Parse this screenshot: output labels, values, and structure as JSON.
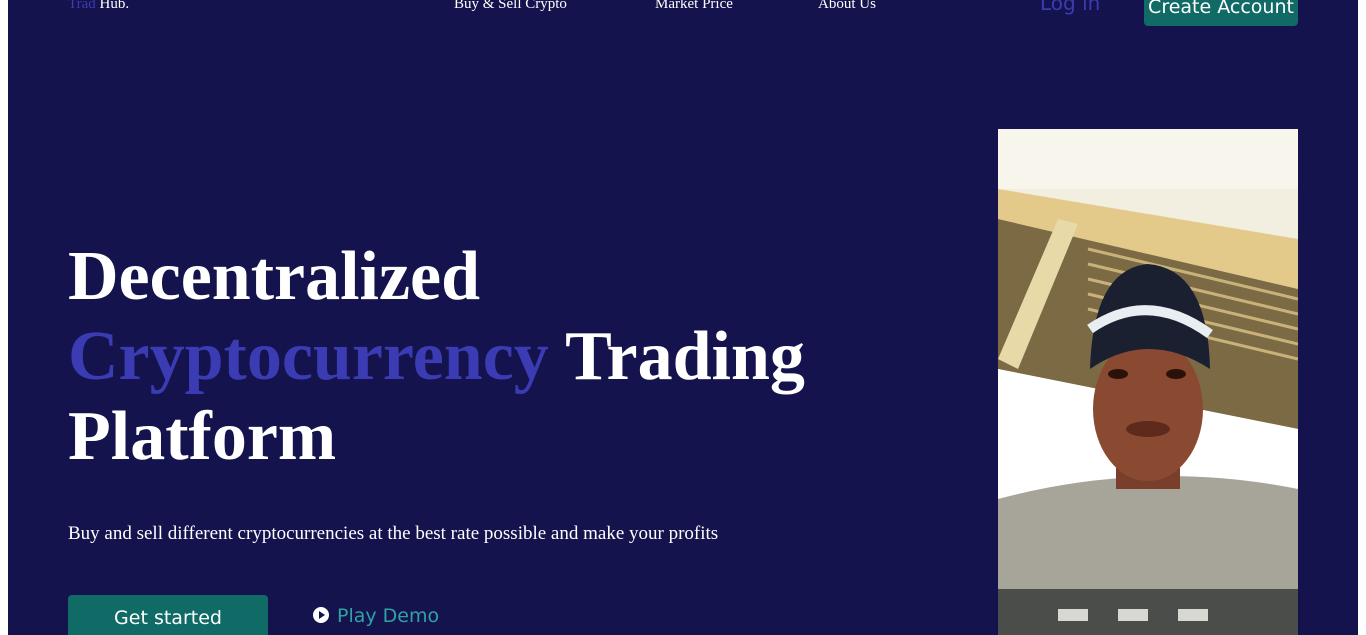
{
  "logo": {
    "accent": "Trad",
    "rest": "Hub."
  },
  "nav": {
    "links": [
      "Buy & Sell Crypto",
      "Market Price",
      "About Us"
    ],
    "login": "Log in",
    "create_account": "Create Account"
  },
  "hero": {
    "title_line1": "Decentralized",
    "title_accent": "Cryptocurrency",
    "title_rest": "Trading",
    "title_line3": "Platform",
    "subtitle": "Buy and sell different cryptocurrencies at the best rate possible and make your profits",
    "get_started": "Get started",
    "play_demo": "Play Demo"
  },
  "colors": {
    "background": "#14134d",
    "accent": "#3b3bb3",
    "button": "#106a66",
    "play_demo": "#2fa3a3"
  },
  "icons": {
    "play": "play-circle-icon"
  }
}
